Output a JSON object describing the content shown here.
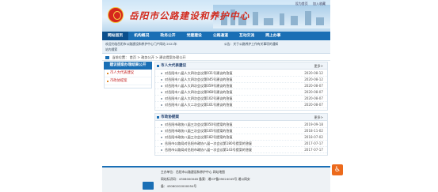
{
  "header": {
    "site_title": "岳阳市公路建设和养护中心",
    "top_links": [
      "设为首页",
      "加入收藏"
    ]
  },
  "nav": {
    "items": [
      "网站首页",
      "机构概况",
      "政务公开",
      "党建建设",
      "公路通道",
      "互动交流",
      "网上办事"
    ]
  },
  "subbar": {
    "line1": "欢迎光临岳阳市公路建设和养护中心门户网站 2021年",
    "line2": "站内搜索",
    "line3": "公告：关于公路养护工作有关事项的通知"
  },
  "breadcrumb": {
    "prefix": "当前位置：",
    "path": "首页 > 政务公开 > 建议提案办理公开"
  },
  "sidebar": {
    "title": "建议提案办理结果公开",
    "items": [
      "市人大代表建议",
      "市政协提案"
    ]
  },
  "panels": [
    {
      "title": "市人大代表建议",
      "more": "更多>",
      "items": [
        {
          "title": "对岳阳市八届人大四次会议第031号建议的答复",
          "date": "2020-08-12"
        },
        {
          "title": "对岳阳市八届人大四次会议第045号建议的答复",
          "date": "2020-08-12"
        },
        {
          "title": "对岳阳市八届人大四次会议第059号建议的答复",
          "date": "2020-08-07"
        },
        {
          "title": "对岳阳市八届人大四次会议第068号建议的答复",
          "date": "2020-08-07"
        },
        {
          "title": "对岳阳市八届人大四次会议第102号建议的答复",
          "date": "2020-08-07"
        },
        {
          "title": "对岳阳市八届人大二次会议第101号建议的答复",
          "date": "2020-08-07"
        }
      ]
    },
    {
      "title": "市政协提案",
      "more": "更多>",
      "items": [
        {
          "title": "对岳阳市政协八届三次会议第050号提案的答复",
          "date": "2019-09-18"
        },
        {
          "title": "对岳阳市政协八届三次会议第105号提案的答复",
          "date": "2018-11-02"
        },
        {
          "title": "对岳阳市政协八届三次会议第182号提案的答复",
          "date": "2018-07-02"
        },
        {
          "title": "岳阳市公路局对岳阳市政协八届一次会议第180号提案的答复",
          "date": "2017-07-17"
        },
        {
          "title": "岳阳市公路局对岳阳市政协八届一次会议第143号提案的答复",
          "date": "2017-07-17"
        }
      ]
    }
  ],
  "footer": {
    "line1": "主办单位：岳阳市公路建设和养护中心  网站地图",
    "line2": "网站标识码：4306000048  备案：湘ICP备09024045号  湘公网安",
    "line3": "备：43060202000054号"
  },
  "accessibility": {
    "glyph": "♿"
  }
}
